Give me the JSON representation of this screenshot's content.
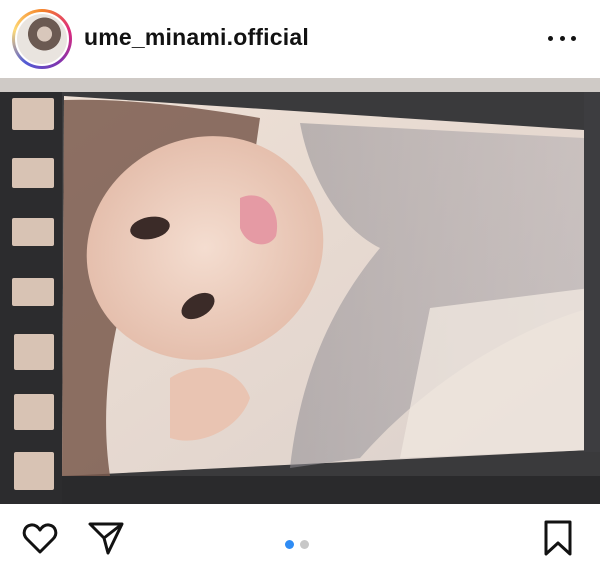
{
  "post": {
    "username": "ume_minami.official"
  },
  "carousel": {
    "total": 2,
    "active_index": 1
  },
  "colors": {
    "accent": "#2f8cf4",
    "inactive_dot": "#c7c7c7",
    "icon": "#121212"
  },
  "icons": {
    "more": "more-options-icon",
    "like": "heart-icon",
    "share": "paper-plane-icon",
    "save": "bookmark-icon"
  }
}
